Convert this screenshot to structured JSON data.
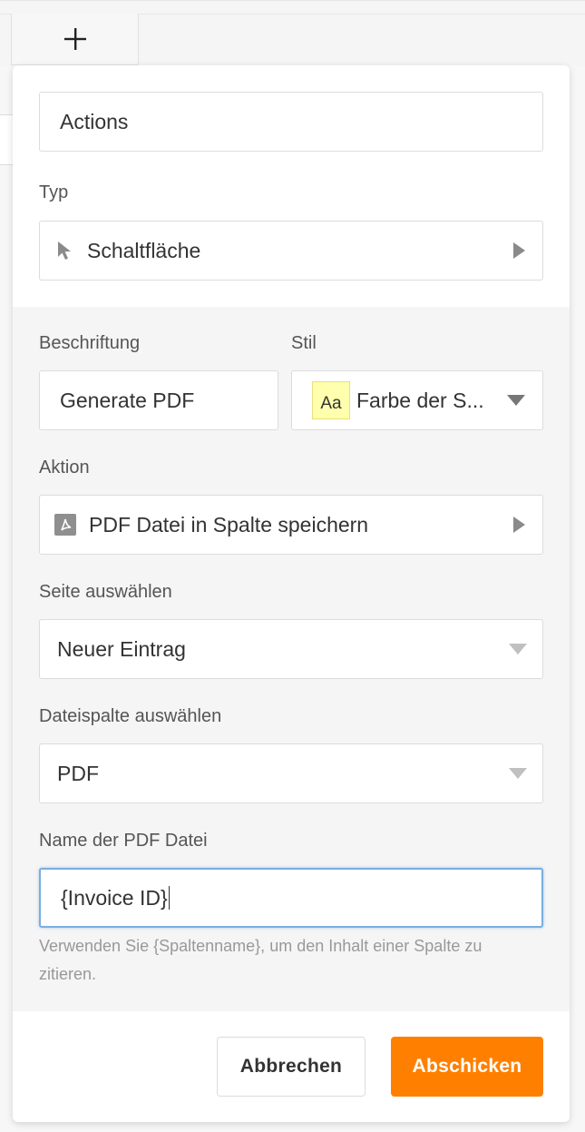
{
  "toolbar": {
    "add_column_icon": "plus-icon"
  },
  "form": {
    "column_name": {
      "value": "Actions"
    },
    "type": {
      "label": "Typ",
      "value": "Schaltfläche",
      "icon": "cursor-arrow-icon"
    },
    "caption": {
      "label": "Beschriftung",
      "value": "Generate PDF"
    },
    "style": {
      "label": "Stil",
      "swatch_text": "Aa",
      "swatch_color": "#ffffae",
      "value": "Farbe der S..."
    },
    "action": {
      "label": "Aktion",
      "value": "PDF Datei in Spalte speichern",
      "icon": "pdf-icon"
    },
    "page": {
      "label": "Seite auswählen",
      "value": "Neuer Eintrag"
    },
    "file_column": {
      "label": "Dateispalte auswählen",
      "value": "PDF"
    },
    "pdf_name": {
      "label": "Name der PDF Datei",
      "value": "{Invoice ID}",
      "focus_color": "#6fa8dc"
    },
    "hint": "Verwenden Sie {Spaltenname}, um den Inhalt einer Spalte zu zitieren."
  },
  "buttons": {
    "cancel": "Abbrechen",
    "submit": "Abschicken",
    "submit_color": "#ff8000"
  }
}
